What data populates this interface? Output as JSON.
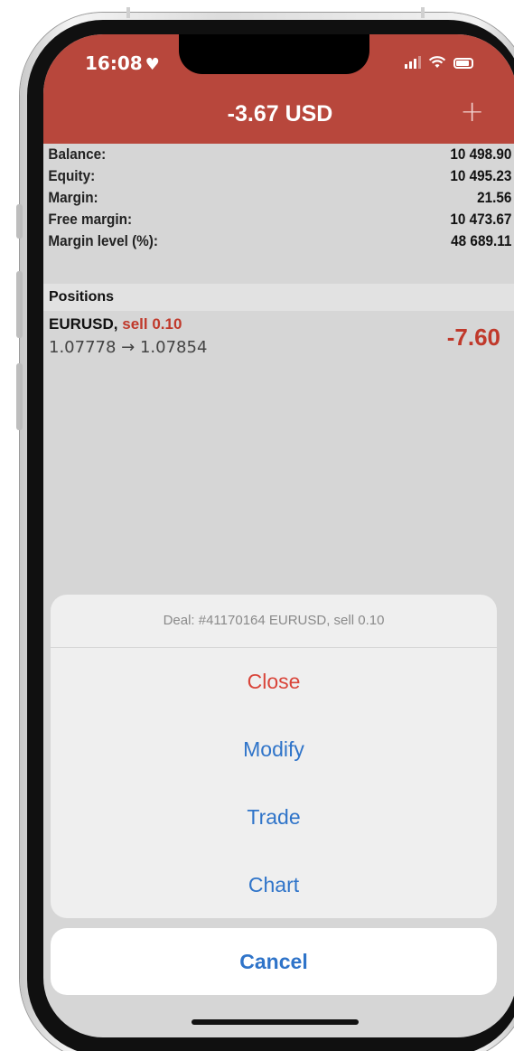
{
  "status_bar": {
    "time": "16:08"
  },
  "header": {
    "title": "-3.67 USD"
  },
  "summary": [
    {
      "label": "Balance:",
      "value": "10 498.90"
    },
    {
      "label": "Equity:",
      "value": "10 495.23"
    },
    {
      "label": "Margin:",
      "value": "21.56"
    },
    {
      "label": "Free margin:",
      "value": "10 473.67"
    },
    {
      "label": "Margin level (%):",
      "value": "48 689.11"
    }
  ],
  "positions": {
    "header": "Positions",
    "items": [
      {
        "symbol": "EURUSD,",
        "side": "sell 0.10",
        "prices": "1.07778 → 1.07854",
        "profit": "-7.60"
      }
    ]
  },
  "action_sheet": {
    "title": "Deal: #41170164 EURUSD, sell 0.10",
    "actions": [
      "Close",
      "Modify",
      "Trade",
      "Chart"
    ],
    "cancel": "Cancel"
  },
  "colors": {
    "header_bg": "#b8473c",
    "accent": "#2f74c9",
    "loss": "#c0392b"
  },
  "icons": {
    "heart": "heart-icon",
    "signal": "signal-icon",
    "wifi": "wifi-icon",
    "battery": "battery-icon",
    "add": "plus-icon"
  }
}
